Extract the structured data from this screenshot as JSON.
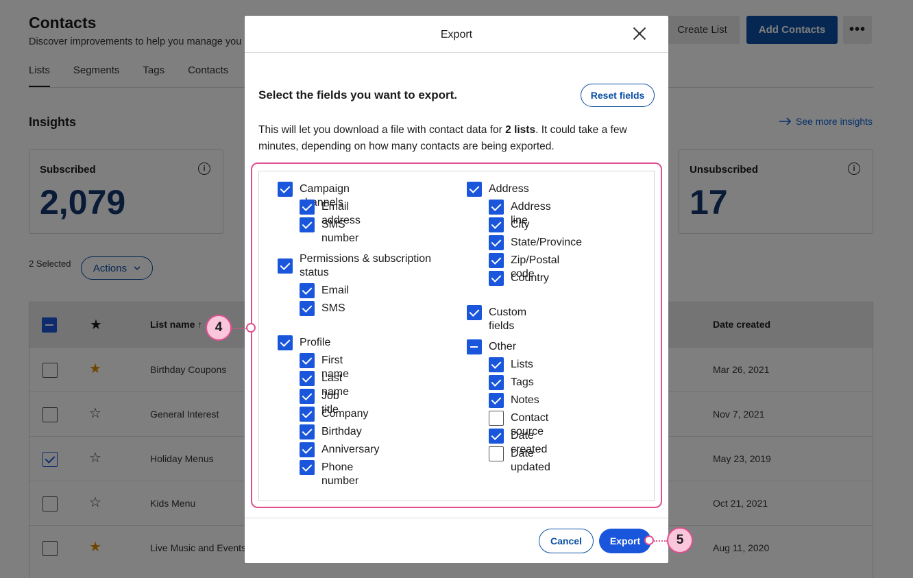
{
  "page": {
    "title": "Contacts",
    "subtitle": "Discover improvements to help you manage you",
    "create_list_label": "Create List",
    "add_contacts_label": "Add Contacts",
    "more_label": "•••",
    "tabs": [
      "Lists",
      "Segments",
      "Tags",
      "Contacts"
    ],
    "insights_title": "Insights",
    "insights_link": "See more insights",
    "cards": {
      "subscribed": {
        "label": "Subscribed",
        "value": "2,079"
      },
      "unsubscribed": {
        "label": "Unsubscribed",
        "value": "17"
      }
    },
    "selected_count": "2 Selected",
    "actions_label": "Actions",
    "table": {
      "col_name": "List name",
      "col_date": "Date created",
      "rows": [
        {
          "name": "Birthday Coupons",
          "date": "Mar 26, 2021"
        },
        {
          "name": "General Interest",
          "date": "Nov 7, 2021"
        },
        {
          "name": "Holiday Menus",
          "date": "May 23, 2019"
        },
        {
          "name": "Kids Menu",
          "date": "Oct 21, 2021"
        },
        {
          "name": "Live Music and Events",
          "date": "Aug 11, 2020"
        }
      ]
    }
  },
  "modal": {
    "title": "Export",
    "heading": "Select the fields you want to export.",
    "reset_label": "Reset fields",
    "desc_before": "This will let you download a file with contact data for ",
    "desc_bold": "2 lists",
    "desc_after": ". It could take a few minutes, depending on how many contacts are being exported.",
    "left_groups": {
      "campaign": {
        "label": "Campaign channels",
        "items": [
          "Email address",
          "SMS number"
        ]
      },
      "permissions": {
        "label": "Permissions & subscription status",
        "items": [
          "Email",
          "SMS"
        ]
      },
      "profile": {
        "label": "Profile",
        "items": [
          "First name",
          "Last name",
          "Job title",
          "Company",
          "Birthday",
          "Anniversary",
          "Phone number"
        ]
      }
    },
    "right_groups": {
      "address": {
        "label": "Address",
        "items": [
          "Address line",
          "City",
          "State/Province",
          "Zip/Postal code",
          "Country"
        ]
      },
      "custom": {
        "label": "Custom fields"
      },
      "other": {
        "label": "Other",
        "items": [
          "Lists",
          "Tags",
          "Notes",
          "Contact source",
          "Date created",
          "Date updated"
        ]
      }
    },
    "cancel_label": "Cancel",
    "export_label": "Export"
  },
  "annotations": {
    "step4": "4",
    "step5": "5"
  },
  "colors": {
    "accent": "#1a56db",
    "brand_dark": "#0b4ea2",
    "annotation": "#e0508f"
  }
}
